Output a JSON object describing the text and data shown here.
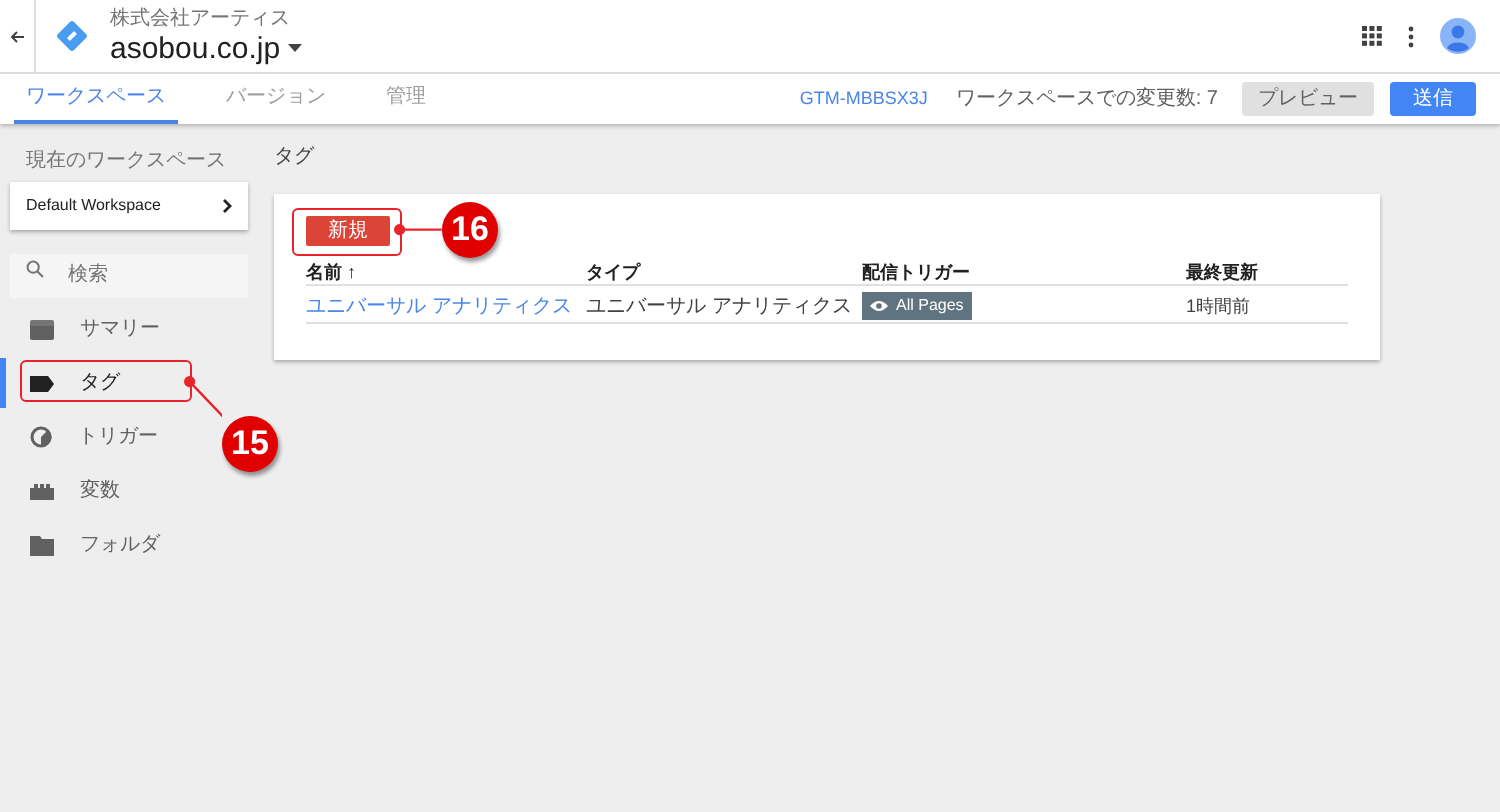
{
  "header": {
    "company": "株式会社アーティス",
    "account": "asobou.co.jp"
  },
  "tabs": [
    {
      "label": "ワークスペース",
      "selected": true
    },
    {
      "label": "バージョン",
      "selected": false
    },
    {
      "label": "管理",
      "selected": false
    }
  ],
  "toolbar": {
    "container_id": "GTM-MBBSX3J",
    "changes": "ワークスペースでの変更数: 7",
    "preview": "プレビュー",
    "submit": "送信"
  },
  "sidebar": {
    "workspace_label": "現在のワークスペース",
    "workspace": "Default Workspace",
    "search_placeholder": "検索",
    "items": [
      {
        "label": "サマリー",
        "kind": "summary",
        "selected": false
      },
      {
        "label": "タグ",
        "kind": "tag",
        "selected": true
      },
      {
        "label": "トリガー",
        "kind": "trigger",
        "selected": false
      },
      {
        "label": "変数",
        "kind": "variable",
        "selected": false
      },
      {
        "label": "フォルダ",
        "kind": "folder",
        "selected": false
      }
    ]
  },
  "page_title": "タグ",
  "table": {
    "new_button": "新規",
    "columns": [
      "名前 ↑",
      "タイプ",
      "配信トリガー",
      "最終更新"
    ],
    "rows": [
      {
        "name": "ユニバーサル アナリティクス",
        "type": "ユニバーサル アナリティクス",
        "trigger": "All Pages",
        "updated": "1時間前"
      }
    ]
  },
  "annotations": [
    {
      "number": "15"
    },
    {
      "number": "16"
    }
  ]
}
